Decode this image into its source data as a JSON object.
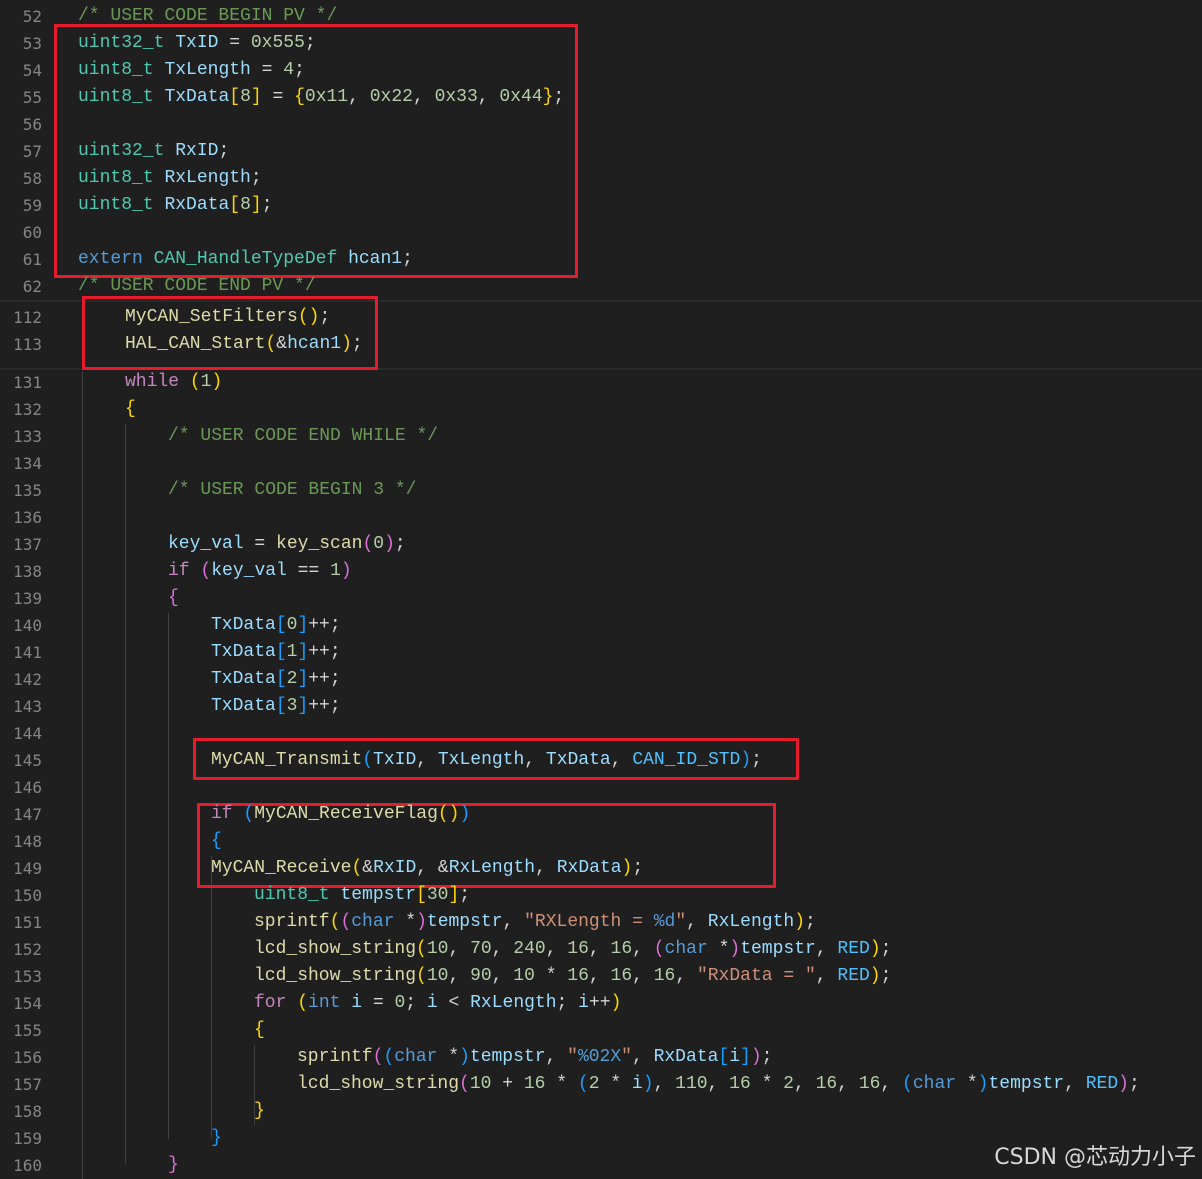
{
  "editor": {
    "lines": [
      {
        "n": "52",
        "tokens": [
          [
            "com",
            "/* USER CODE BEGIN PV */"
          ]
        ]
      },
      {
        "n": "53",
        "tokens": [
          [
            "type",
            "uint32_t"
          ],
          [
            "p",
            " "
          ],
          [
            "var",
            "TxID"
          ],
          [
            "p",
            " = "
          ],
          [
            "num",
            "0x555"
          ],
          [
            "p",
            ";"
          ]
        ]
      },
      {
        "n": "54",
        "tokens": [
          [
            "type",
            "uint8_t"
          ],
          [
            "p",
            " "
          ],
          [
            "var",
            "TxLength"
          ],
          [
            "p",
            " = "
          ],
          [
            "num",
            "4"
          ],
          [
            "p",
            ";"
          ]
        ]
      },
      {
        "n": "55",
        "tokens": [
          [
            "type",
            "uint8_t"
          ],
          [
            "p",
            " "
          ],
          [
            "var",
            "TxData"
          ],
          [
            "b1",
            "["
          ],
          [
            "num",
            "8"
          ],
          [
            "b1",
            "]"
          ],
          [
            "p",
            " = "
          ],
          [
            "b1",
            "{"
          ],
          [
            "num",
            "0x11"
          ],
          [
            "p",
            ", "
          ],
          [
            "num",
            "0x22"
          ],
          [
            "p",
            ", "
          ],
          [
            "num",
            "0x33"
          ],
          [
            "p",
            ", "
          ],
          [
            "num",
            "0x44"
          ],
          [
            "b1",
            "}"
          ],
          [
            "p",
            ";"
          ]
        ]
      },
      {
        "n": "56",
        "tokens": []
      },
      {
        "n": "57",
        "tokens": [
          [
            "type",
            "uint32_t"
          ],
          [
            "p",
            " "
          ],
          [
            "var",
            "RxID"
          ],
          [
            "p",
            ";"
          ]
        ]
      },
      {
        "n": "58",
        "tokens": [
          [
            "type",
            "uint8_t"
          ],
          [
            "p",
            " "
          ],
          [
            "var",
            "RxLength"
          ],
          [
            "p",
            ";"
          ]
        ]
      },
      {
        "n": "59",
        "tokens": [
          [
            "type",
            "uint8_t"
          ],
          [
            "p",
            " "
          ],
          [
            "var",
            "RxData"
          ],
          [
            "b1",
            "["
          ],
          [
            "num",
            "8"
          ],
          [
            "b1",
            "]"
          ],
          [
            "p",
            ";"
          ]
        ]
      },
      {
        "n": "60",
        "tokens": []
      },
      {
        "n": "61",
        "tokens": [
          [
            "kw",
            "extern"
          ],
          [
            "p",
            " "
          ],
          [
            "type",
            "CAN_HandleTypeDef"
          ],
          [
            "p",
            " "
          ],
          [
            "var",
            "hcan1"
          ],
          [
            "p",
            ";"
          ]
        ]
      },
      {
        "n": "62",
        "tokens": [
          [
            "com",
            "/* USER CODE END PV */"
          ]
        ]
      },
      {
        "n": "112",
        "tokens": [
          [
            "fn",
            "MyCAN_SetFilters"
          ],
          [
            "b1",
            "()"
          ],
          [
            "p",
            ";"
          ]
        ]
      },
      {
        "n": "113",
        "tokens": [
          [
            "fn",
            "HAL_CAN_Start"
          ],
          [
            "b1",
            "("
          ],
          [
            "p",
            "&"
          ],
          [
            "var",
            "hcan1"
          ],
          [
            "b1",
            ")"
          ],
          [
            "p",
            ";"
          ]
        ]
      },
      {
        "n": "131",
        "tokens": [
          [
            "ctrl",
            "while"
          ],
          [
            "p",
            " "
          ],
          [
            "b1",
            "("
          ],
          [
            "num",
            "1"
          ],
          [
            "b1",
            ")"
          ]
        ]
      },
      {
        "n": "132",
        "tokens": [
          [
            "b1",
            "{"
          ]
        ]
      },
      {
        "n": "133",
        "tokens": [
          [
            "com",
            "/* USER CODE END WHILE */"
          ]
        ]
      },
      {
        "n": "134",
        "tokens": []
      },
      {
        "n": "135",
        "tokens": [
          [
            "com",
            "/* USER CODE BEGIN 3 */"
          ]
        ]
      },
      {
        "n": "136",
        "tokens": []
      },
      {
        "n": "137",
        "tokens": [
          [
            "var",
            "key_val"
          ],
          [
            "p",
            " = "
          ],
          [
            "fn",
            "key_scan"
          ],
          [
            "b2",
            "("
          ],
          [
            "num",
            "0"
          ],
          [
            "b2",
            ")"
          ],
          [
            "p",
            ";"
          ]
        ]
      },
      {
        "n": "138",
        "tokens": [
          [
            "ctrl",
            "if"
          ],
          [
            "p",
            " "
          ],
          [
            "b2",
            "("
          ],
          [
            "var",
            "key_val"
          ],
          [
            "p",
            " == "
          ],
          [
            "num",
            "1"
          ],
          [
            "b2",
            ")"
          ]
        ]
      },
      {
        "n": "139",
        "tokens": [
          [
            "b2",
            "{"
          ]
        ]
      },
      {
        "n": "140",
        "tokens": [
          [
            "var",
            "TxData"
          ],
          [
            "b3",
            "["
          ],
          [
            "num",
            "0"
          ],
          [
            "b3",
            "]"
          ],
          [
            "p",
            "++;"
          ]
        ]
      },
      {
        "n": "141",
        "tokens": [
          [
            "var",
            "TxData"
          ],
          [
            "b3",
            "["
          ],
          [
            "num",
            "1"
          ],
          [
            "b3",
            "]"
          ],
          [
            "p",
            "++;"
          ]
        ]
      },
      {
        "n": "142",
        "tokens": [
          [
            "var",
            "TxData"
          ],
          [
            "b3",
            "["
          ],
          [
            "num",
            "2"
          ],
          [
            "b3",
            "]"
          ],
          [
            "p",
            "++;"
          ]
        ]
      },
      {
        "n": "143",
        "tokens": [
          [
            "var",
            "TxData"
          ],
          [
            "b3",
            "["
          ],
          [
            "num",
            "3"
          ],
          [
            "b3",
            "]"
          ],
          [
            "p",
            "++;"
          ]
        ]
      },
      {
        "n": "144",
        "tokens": []
      },
      {
        "n": "145",
        "tokens": [
          [
            "fn",
            "MyCAN_Transmit"
          ],
          [
            "b3",
            "("
          ],
          [
            "var",
            "TxID"
          ],
          [
            "p",
            ", "
          ],
          [
            "var",
            "TxLength"
          ],
          [
            "p",
            ", "
          ],
          [
            "var",
            "TxData"
          ],
          [
            "p",
            ", "
          ],
          [
            "const",
            "CAN_ID_STD"
          ],
          [
            "b3",
            ")"
          ],
          [
            "p",
            ";"
          ]
        ]
      },
      {
        "n": "146",
        "tokens": []
      },
      {
        "n": "147",
        "tokens": [
          [
            "ctrl",
            "if"
          ],
          [
            "p",
            " "
          ],
          [
            "b3",
            "("
          ],
          [
            "fn",
            "MyCAN_ReceiveFlag"
          ],
          [
            "b1",
            "()"
          ],
          [
            "b3",
            ")"
          ]
        ]
      },
      {
        "n": "148",
        "tokens": [
          [
            "b3",
            "{"
          ]
        ]
      },
      {
        "n": "149",
        "tokens": [
          [
            "fn",
            "MyCAN_Receive"
          ],
          [
            "b1",
            "("
          ],
          [
            "p",
            "&"
          ],
          [
            "var",
            "RxID"
          ],
          [
            "p",
            ", &"
          ],
          [
            "var",
            "RxLength"
          ],
          [
            "p",
            ", "
          ],
          [
            "var",
            "RxData"
          ],
          [
            "b1",
            ")"
          ],
          [
            "p",
            ";"
          ]
        ]
      },
      {
        "n": "150",
        "tokens": [
          [
            "type",
            "uint8_t"
          ],
          [
            "p",
            " "
          ],
          [
            "var",
            "tempstr"
          ],
          [
            "b1",
            "["
          ],
          [
            "num",
            "30"
          ],
          [
            "b1",
            "]"
          ],
          [
            "p",
            ";"
          ]
        ]
      },
      {
        "n": "151",
        "tokens": [
          [
            "fn",
            "sprintf"
          ],
          [
            "b1",
            "("
          ],
          [
            "b2",
            "("
          ],
          [
            "kw",
            "char"
          ],
          [
            "p",
            " *"
          ],
          [
            "b2",
            ")"
          ],
          [
            "var",
            "tempstr"
          ],
          [
            "p",
            ", "
          ],
          [
            "str",
            "\"RXLength = "
          ],
          [
            "kw",
            "%d"
          ],
          [
            "str",
            "\""
          ],
          [
            "p",
            ", "
          ],
          [
            "var",
            "RxLength"
          ],
          [
            "b1",
            ")"
          ],
          [
            "p",
            ";"
          ]
        ]
      },
      {
        "n": "152",
        "tokens": [
          [
            "fn",
            "lcd_show_string"
          ],
          [
            "b1",
            "("
          ],
          [
            "num",
            "10"
          ],
          [
            "p",
            ", "
          ],
          [
            "num",
            "70"
          ],
          [
            "p",
            ", "
          ],
          [
            "num",
            "240"
          ],
          [
            "p",
            ", "
          ],
          [
            "num",
            "16"
          ],
          [
            "p",
            ", "
          ],
          [
            "num",
            "16"
          ],
          [
            "p",
            ", "
          ],
          [
            "b2",
            "("
          ],
          [
            "kw",
            "char"
          ],
          [
            "p",
            " *"
          ],
          [
            "b2",
            ")"
          ],
          [
            "var",
            "tempstr"
          ],
          [
            "p",
            ", "
          ],
          [
            "const",
            "RED"
          ],
          [
            "b1",
            ")"
          ],
          [
            "p",
            ";"
          ]
        ]
      },
      {
        "n": "153",
        "tokens": [
          [
            "fn",
            "lcd_show_string"
          ],
          [
            "b1",
            "("
          ],
          [
            "num",
            "10"
          ],
          [
            "p",
            ", "
          ],
          [
            "num",
            "90"
          ],
          [
            "p",
            ", "
          ],
          [
            "num",
            "10"
          ],
          [
            "p",
            " * "
          ],
          [
            "num",
            "16"
          ],
          [
            "p",
            ", "
          ],
          [
            "num",
            "16"
          ],
          [
            "p",
            ", "
          ],
          [
            "num",
            "16"
          ],
          [
            "p",
            ", "
          ],
          [
            "str",
            "\"RxData = \""
          ],
          [
            "p",
            ", "
          ],
          [
            "const",
            "RED"
          ],
          [
            "b1",
            ")"
          ],
          [
            "p",
            ";"
          ]
        ]
      },
      {
        "n": "154",
        "tokens": [
          [
            "ctrl",
            "for"
          ],
          [
            "p",
            " "
          ],
          [
            "b1",
            "("
          ],
          [
            "kw",
            "int"
          ],
          [
            "p",
            " "
          ],
          [
            "var",
            "i"
          ],
          [
            "p",
            " = "
          ],
          [
            "num",
            "0"
          ],
          [
            "p",
            "; "
          ],
          [
            "var",
            "i"
          ],
          [
            "p",
            " < "
          ],
          [
            "var",
            "RxLength"
          ],
          [
            "p",
            "; "
          ],
          [
            "var",
            "i"
          ],
          [
            "p",
            "++"
          ],
          [
            "b1",
            ")"
          ]
        ]
      },
      {
        "n": "155",
        "tokens": [
          [
            "b1",
            "{"
          ]
        ]
      },
      {
        "n": "156",
        "tokens": [
          [
            "fn",
            "sprintf"
          ],
          [
            "b2",
            "("
          ],
          [
            "b3",
            "("
          ],
          [
            "kw",
            "char"
          ],
          [
            "p",
            " *"
          ],
          [
            "b3",
            ")"
          ],
          [
            "var",
            "tempstr"
          ],
          [
            "p",
            ", "
          ],
          [
            "str",
            "\""
          ],
          [
            "kw",
            "%02X"
          ],
          [
            "str",
            "\""
          ],
          [
            "p",
            ", "
          ],
          [
            "var",
            "RxData"
          ],
          [
            "b3",
            "["
          ],
          [
            "var",
            "i"
          ],
          [
            "b3",
            "]"
          ],
          [
            "b2",
            ")"
          ],
          [
            "p",
            ";"
          ]
        ]
      },
      {
        "n": "157",
        "tokens": [
          [
            "fn",
            "lcd_show_string"
          ],
          [
            "b2",
            "("
          ],
          [
            "num",
            "10"
          ],
          [
            "p",
            " + "
          ],
          [
            "num",
            "16"
          ],
          [
            "p",
            " * "
          ],
          [
            "b3",
            "("
          ],
          [
            "num",
            "2"
          ],
          [
            "p",
            " * "
          ],
          [
            "var",
            "i"
          ],
          [
            "b3",
            ")"
          ],
          [
            "p",
            ", "
          ],
          [
            "num",
            "110"
          ],
          [
            "p",
            ", "
          ],
          [
            "num",
            "16"
          ],
          [
            "p",
            " * "
          ],
          [
            "num",
            "2"
          ],
          [
            "p",
            ", "
          ],
          [
            "num",
            "16"
          ],
          [
            "p",
            ", "
          ],
          [
            "num",
            "16"
          ],
          [
            "p",
            ", "
          ],
          [
            "b3",
            "("
          ],
          [
            "kw",
            "char"
          ],
          [
            "p",
            " *"
          ],
          [
            "b3",
            ")"
          ],
          [
            "var",
            "tempstr"
          ],
          [
            "p",
            ", "
          ],
          [
            "const",
            "RED"
          ],
          [
            "b2",
            ")"
          ],
          [
            "p",
            ";"
          ]
        ]
      },
      {
        "n": "158",
        "tokens": [
          [
            "b1",
            "}"
          ]
        ]
      },
      {
        "n": "159",
        "tokens": [
          [
            "b3",
            "}"
          ]
        ]
      },
      {
        "n": "160",
        "tokens": [
          [
            "b2",
            "}"
          ]
        ]
      }
    ]
  },
  "watermark": "CSDN @芯动力小子",
  "colors": {
    "highlight_box": "#e41c2b",
    "background": "#1f1f1f"
  }
}
